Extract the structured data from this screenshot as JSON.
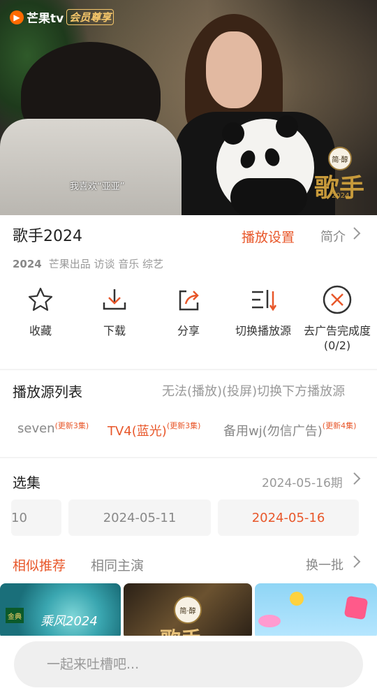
{
  "video": {
    "logo_text": "芒果tv",
    "logo_vip": "会员尊享",
    "logo_icon": "mango-icon",
    "subtitle": "我喜欢“亚亚”",
    "brand_badge": "简·醇",
    "show_badge": "歌手",
    "show_badge_year": "2024"
  },
  "info": {
    "title": "歌手2024",
    "play_settings": "播放设置",
    "intro": "简介",
    "year": "2024",
    "tags": "芒果出品 访谈 音乐 综艺"
  },
  "actions": [
    {
      "label": "收藏",
      "icon": "star-icon"
    },
    {
      "label": "下载",
      "icon": "download-icon"
    },
    {
      "label": "分享",
      "icon": "share-icon"
    },
    {
      "label": "切换播放源",
      "icon": "switch-source-icon"
    },
    {
      "label": "去广告完成度\n(0/2)",
      "icon": "remove-ad-icon"
    }
  ],
  "sources": {
    "heading": "播放源列表",
    "hint": "无法(播放)(投屏)切换下方播放源",
    "items": [
      {
        "name": "seven",
        "update": "(更新3集)"
      },
      {
        "name": "TV4(蓝光)",
        "update": "(更新3集)"
      },
      {
        "name": "备用wj(勿信广告)",
        "update": "(更新4集)"
      }
    ]
  },
  "episodes": {
    "heading": "选集",
    "current": "2024-05-16期",
    "items": [
      "10",
      "2024-05-11",
      "2024-05-16"
    ]
  },
  "recommend": {
    "tab_similar": "相似推荐",
    "tab_cast": "相同主演",
    "refresh": "换一批",
    "thumb1_badge": "金典",
    "thumb1_text": "乘风2024",
    "thumb2_brand": "简·醇",
    "thumb2_text": "歌手"
  },
  "comment": {
    "placeholder": "一起来吐槽吧..."
  },
  "colors": {
    "accent": "#e8572a",
    "muted": "#888888"
  }
}
